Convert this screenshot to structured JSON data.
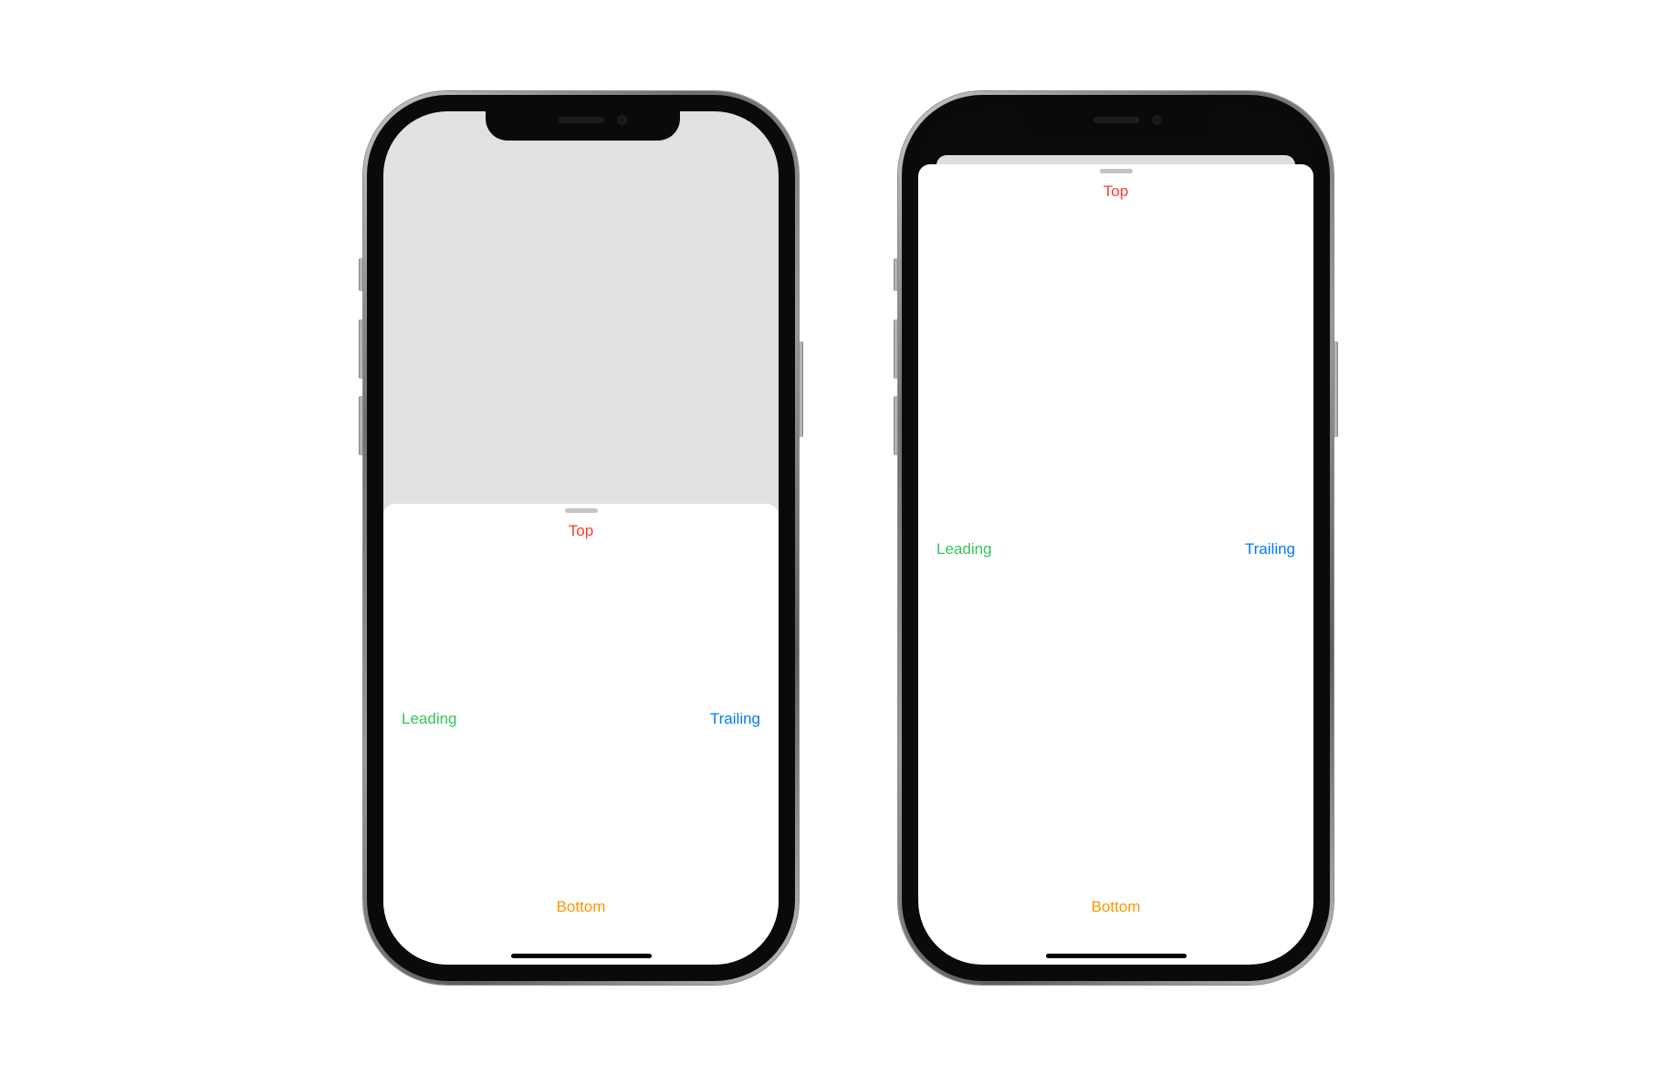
{
  "colors": {
    "top": "#ff3b30",
    "leading": "#34c759",
    "trailing": "#007aff",
    "bottom": "#ff9500",
    "dimmed_background": "#e1e1e1",
    "sheet": "#ffffff"
  },
  "phones": [
    {
      "id": "left",
      "state": "medium detent",
      "sheet": {
        "labels": {
          "top": "Top",
          "leading": "Leading",
          "trailing": "Trailing",
          "bottom": "Bottom"
        }
      }
    },
    {
      "id": "right",
      "state": "large detent",
      "sheet": {
        "labels": {
          "top": "Top",
          "leading": "Leading",
          "trailing": "Trailing",
          "bottom": "Bottom"
        }
      }
    }
  ]
}
